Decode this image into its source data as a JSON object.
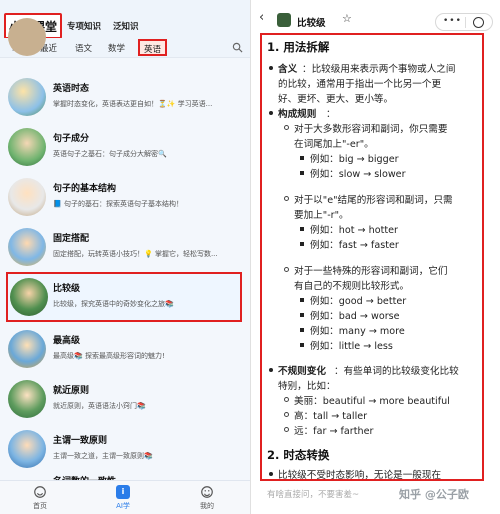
{
  "left": {
    "brand": "小叮课堂",
    "top_tabs": [
      "专项知识",
      "泛知识"
    ],
    "subnav": [
      "最近",
      "语文",
      "数学",
      "英语"
    ],
    "items": [
      {
        "title": "英语时态",
        "desc": "掌握时态变化，英语表达更自如！⏳✨ 学习英语..."
      },
      {
        "title": "句子成分",
        "desc": "英语句子之基石：句子成分大解密🔍"
      },
      {
        "title": "句子的基本结构",
        "desc": "📘 句子的基石：探索英语句子基本结构！"
      },
      {
        "title": "固定搭配",
        "desc": "固定搭配，玩转英语小技巧！💡 掌握它，轻松写数..."
      },
      {
        "title": "比较级",
        "desc": "比较级，探究英语中的奇妙变化之旅📚"
      },
      {
        "title": "最高级",
        "desc": "最高级📚 探索最高级形容词的魅力!"
      },
      {
        "title": "就近原则",
        "desc": "就近原则，英语语法小窍门📚"
      },
      {
        "title": "主谓一致原则",
        "desc": "主谓一致之道，主谓一致原则📚"
      },
      {
        "title": "名词数的一致性",
        "desc": ""
      }
    ],
    "bottom_nav": [
      "首页",
      "AI学",
      "我的"
    ]
  },
  "right": {
    "title": "比较级",
    "lines": [
      "1. 用法拆解",
      "含义",
      "：比较级用来表示两个事物或人之间",
      "的比较，通常用于指出一个比另一个更",
      "好、更坏、更大、更小等。",
      "构成规则",
      "：",
      "对于大多数形容词和副词，你只需要",
      "在词尾加上\"-er\"。",
      "例如：big → bigger",
      "例如：slow → slower",
      "对于以\"e\"结尾的形容词和副词，只需",
      "要加上\"-r\"。",
      "例如：hot → hotter",
      "例如：fast → faster",
      "对于一些特殊的形容词和副词，它们",
      "有自己的不规则比较形式。",
      "例如：good → better",
      "例如：bad → worse",
      "例如：many → more",
      "例如：little → less",
      "不规则变化",
      "：有些单词的比较级变化比较",
      "特别，比如：",
      "美丽：beautiful → more beautiful",
      "高：tall → taller",
      "远：far → farther",
      "2. 时态转换",
      "比较级不受时态影响，无论是一般现在"
    ],
    "input_placeholder": "有啥直接问，不要害羞~",
    "watermark": "知乎 @公子欧"
  },
  "colors": {
    "accent": "#2b7de9",
    "highlight": "#e02020"
  }
}
